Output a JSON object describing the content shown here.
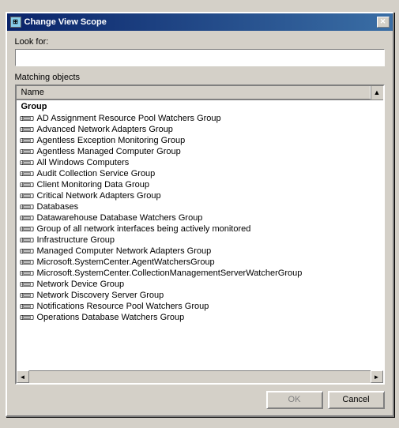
{
  "window": {
    "title": "Change View Scope",
    "close_label": "✕"
  },
  "look_for": {
    "label": "Look for:",
    "value": "",
    "placeholder": ""
  },
  "matching_objects": {
    "label": "Matching objects",
    "column_name": "Name",
    "group_label": "Group",
    "items": [
      "AD Assignment Resource Pool Watchers Group",
      "Advanced Network Adapters Group",
      "Agentless Exception Monitoring Group",
      "Agentless Managed Computer Group",
      "All Windows Computers",
      "Audit Collection Service Group",
      "Client Monitoring Data Group",
      "Critical Network Adapters Group",
      "Databases",
      "Datawarehouse Database Watchers Group",
      "Group of all network interfaces being actively monitored",
      "Infrastructure Group",
      "Managed Computer Network Adapters Group",
      "Microsoft.SystemCenter.AgentWatchersGroup",
      "Microsoft.SystemCenter.CollectionManagementServerWatcherGroup",
      "Network Device Group",
      "Network Discovery Server Group",
      "Notifications Resource Pool Watchers Group",
      "Operations Database Watchers Group"
    ]
  },
  "buttons": {
    "ok_label": "OK",
    "cancel_label": "Cancel"
  }
}
